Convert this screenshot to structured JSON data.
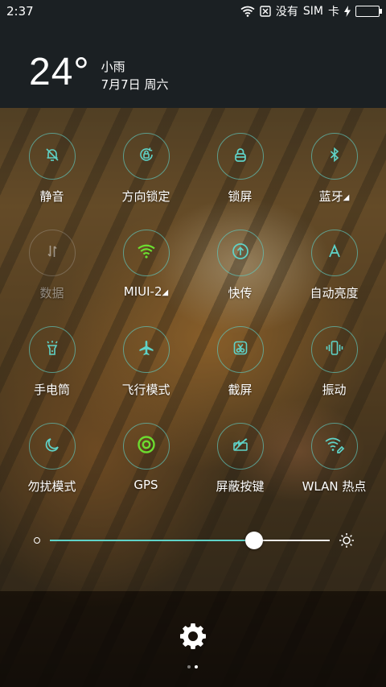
{
  "status_bar": {
    "time": "2:37",
    "carrier": "没有",
    "sim": "SIM",
    "card": "卡",
    "icons": [
      "wifi-icon",
      "no-sim-icon",
      "charging-icon",
      "battery-icon"
    ],
    "battery_color": "#3ee45b"
  },
  "weather": {
    "temperature": "24°",
    "condition": "小雨",
    "date": "7月7日 周六"
  },
  "toggles": [
    {
      "label": "静音",
      "icon": "bell-off-icon",
      "on": true
    },
    {
      "label": "方向锁定",
      "icon": "rotation-lock-icon",
      "on": true
    },
    {
      "label": "锁屏",
      "icon": "lock-icon",
      "on": true
    },
    {
      "label": "蓝牙",
      "icon": "bluetooth-icon",
      "on": true,
      "expand": "◢"
    },
    {
      "label": "数据",
      "icon": "mobile-data-icon",
      "on": false
    },
    {
      "label": "MIUI-2",
      "icon": "wifi-icon",
      "on": true,
      "expand": "◢"
    },
    {
      "label": "快传",
      "icon": "quick-share-icon",
      "on": true
    },
    {
      "label": "自动亮度",
      "icon": "auto-brightness-icon",
      "on": true
    },
    {
      "label": "手电筒",
      "icon": "flashlight-icon",
      "on": true
    },
    {
      "label": "飞行模式",
      "icon": "airplane-icon",
      "on": true
    },
    {
      "label": "截屏",
      "icon": "screenshot-icon",
      "on": true
    },
    {
      "label": "振动",
      "icon": "vibrate-icon",
      "on": true
    },
    {
      "label": "勿扰模式",
      "icon": "moon-icon",
      "on": true
    },
    {
      "label": "GPS",
      "icon": "gps-icon",
      "on": true
    },
    {
      "label": "屏蔽按键",
      "icon": "block-keys-icon",
      "on": true
    },
    {
      "label": "WLAN 热点",
      "icon": "hotspot-icon",
      "on": true
    }
  ],
  "brightness": {
    "level": 0.73
  },
  "colors": {
    "accent": "#5fd3c8",
    "active_green": "#6cdc30"
  },
  "pager": {
    "pages": 2,
    "current": 2
  }
}
